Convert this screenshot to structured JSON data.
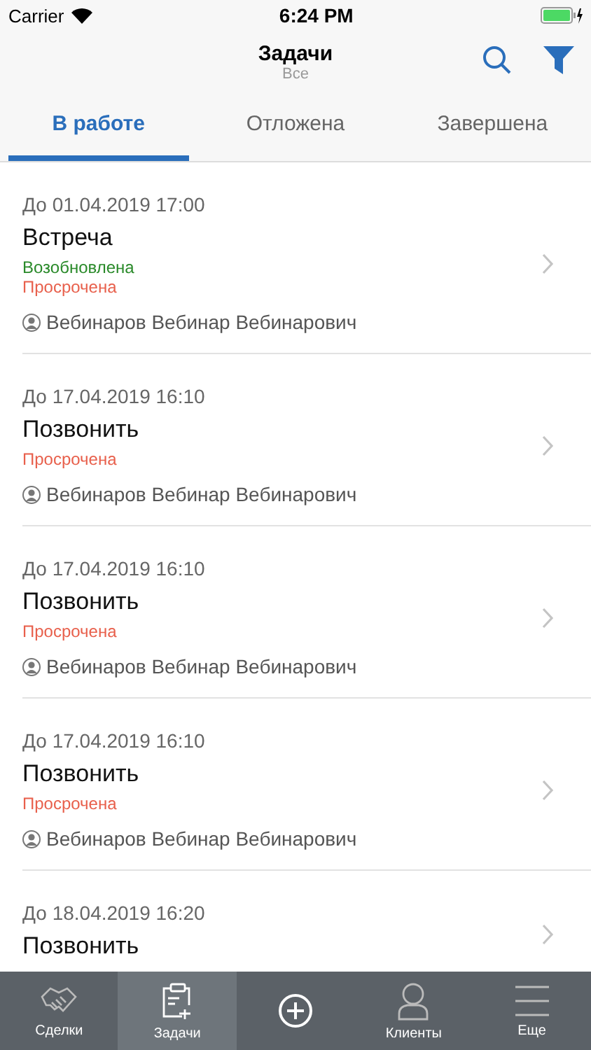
{
  "status_bar": {
    "carrier": "Carrier",
    "time": "6:24 PM"
  },
  "nav": {
    "title": "Задачи",
    "subtitle": "Все"
  },
  "tabs": [
    {
      "label": "В работе",
      "selected": true
    },
    {
      "label": "Отложена",
      "selected": false
    },
    {
      "label": "Завершена",
      "selected": false
    }
  ],
  "tasks": [
    {
      "due": "До 01.04.2019 17:00",
      "title": "Встреча",
      "statuses": [
        {
          "kind": "resumed",
          "label": "Возобновлена"
        },
        {
          "kind": "overdue",
          "label": "Просрочена"
        }
      ],
      "assignee": "Вебинаров Вебинар Вебинарович"
    },
    {
      "due": "До 17.04.2019 16:10",
      "title": "Позвонить",
      "statuses": [
        {
          "kind": "overdue",
          "label": "Просрочена"
        }
      ],
      "assignee": "Вебинаров Вебинар Вебинарович"
    },
    {
      "due": "До 17.04.2019 16:10",
      "title": "Позвонить",
      "statuses": [
        {
          "kind": "overdue",
          "label": "Просрочена"
        }
      ],
      "assignee": "Вебинаров Вебинар Вебинарович"
    },
    {
      "due": "До 17.04.2019 16:10",
      "title": "Позвонить",
      "statuses": [
        {
          "kind": "overdue",
          "label": "Просрочена"
        }
      ],
      "assignee": "Вебинаров Вебинар Вебинарович"
    },
    {
      "due": "До 18.04.2019 16:20",
      "title": "Позвонить"
    }
  ],
  "tab_bar": [
    {
      "kind": "deals",
      "label": "Сделки",
      "selected": false
    },
    {
      "kind": "tasks",
      "label": "Задачи",
      "selected": true
    },
    {
      "kind": "add",
      "selected": false
    },
    {
      "kind": "clients",
      "label": "Клиенты",
      "selected": false
    },
    {
      "kind": "more",
      "label": "Еще",
      "selected": false
    }
  ]
}
